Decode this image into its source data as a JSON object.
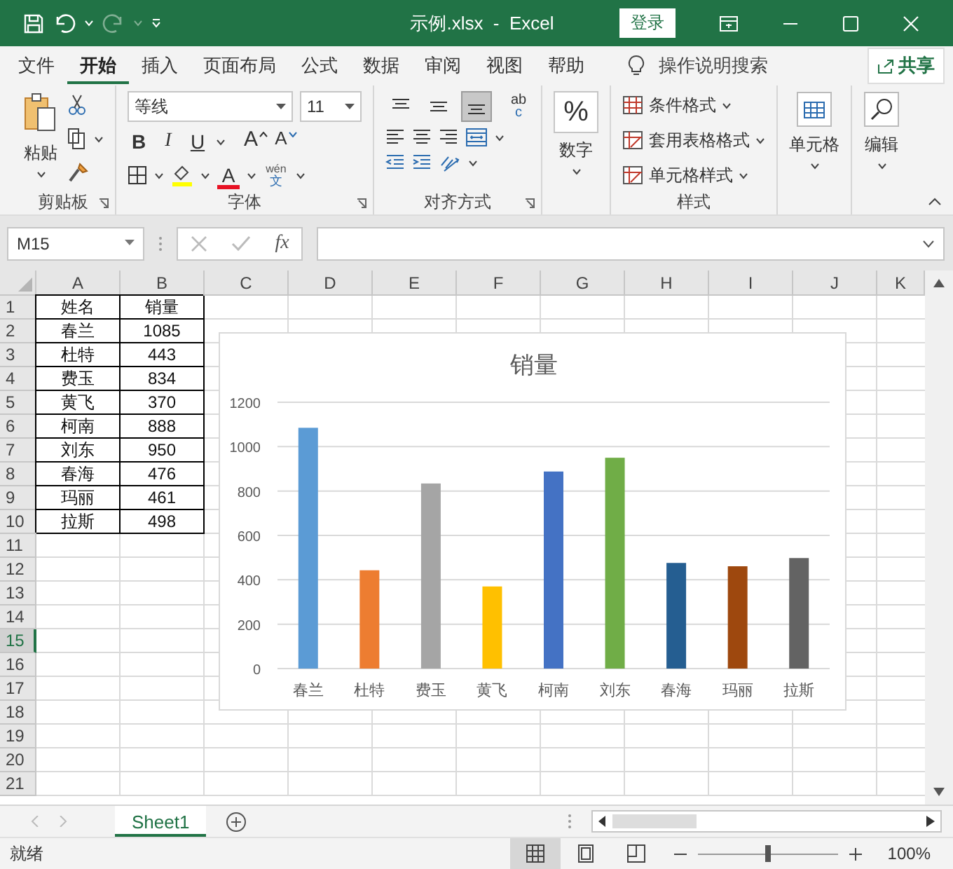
{
  "title_bar": {
    "title": "示例.xlsx  -  Excel",
    "login": "登录"
  },
  "ribbon_tabs": [
    {
      "label": "文件",
      "selected": false
    },
    {
      "label": "开始",
      "selected": true
    },
    {
      "label": "插入",
      "selected": false
    },
    {
      "label": "页面布局",
      "selected": false
    },
    {
      "label": "公式",
      "selected": false
    },
    {
      "label": "数据",
      "selected": false
    },
    {
      "label": "审阅",
      "selected": false
    },
    {
      "label": "视图",
      "selected": false
    },
    {
      "label": "帮助",
      "selected": false
    }
  ],
  "tell_me": "操作说明搜索",
  "share": "共享",
  "ribbon": {
    "clipboard": {
      "paste": "粘贴",
      "label": "剪贴板"
    },
    "font": {
      "name": "等线",
      "size": "11",
      "bold": "B",
      "italic": "I",
      "underline": "U",
      "grow": "A",
      "shrink": "A",
      "font_color": "A",
      "phonetic_top": "wén",
      "phonetic_bottom": "文",
      "label": "字体"
    },
    "alignment": {
      "vertical_align": [
        {
          "selected": false
        },
        {
          "selected": false
        },
        {
          "selected": true
        }
      ],
      "wrap_top": "ab",
      "wrap_bottom": "c",
      "label": "对齐方式"
    },
    "number": {
      "symbol": "%",
      "label": "数字"
    },
    "styles": {
      "items": [
        "条件格式",
        "套用表格格式",
        "单元格样式"
      ],
      "label": "样式"
    },
    "cells": {
      "label": "单元格"
    },
    "editing": {
      "label": "编辑"
    }
  },
  "formula_bar": {
    "name_box": "M15",
    "fx": "fx"
  },
  "sheet": {
    "columns": [
      "A",
      "B",
      "C",
      "D",
      "E",
      "F",
      "G",
      "H",
      "I",
      "J",
      "K"
    ],
    "row_headers": [
      {
        "label": "1",
        "selected": false
      },
      {
        "label": "2",
        "selected": false
      },
      {
        "label": "3",
        "selected": false
      },
      {
        "label": "4",
        "selected": false
      },
      {
        "label": "5",
        "selected": false
      },
      {
        "label": "6",
        "selected": false
      },
      {
        "label": "7",
        "selected": false
      },
      {
        "label": "8",
        "selected": false
      },
      {
        "label": "9",
        "selected": false
      },
      {
        "label": "10",
        "selected": false
      },
      {
        "label": "11",
        "selected": false
      },
      {
        "label": "12",
        "selected": false
      },
      {
        "label": "13",
        "selected": false
      },
      {
        "label": "14",
        "selected": false
      },
      {
        "label": "15",
        "selected": true
      },
      {
        "label": "16",
        "selected": false
      },
      {
        "label": "17",
        "selected": false
      },
      {
        "label": "18",
        "selected": false
      },
      {
        "label": "19",
        "selected": false
      },
      {
        "label": "20",
        "selected": false
      },
      {
        "label": "21",
        "selected": false
      }
    ],
    "cells": [
      [
        "姓名",
        "销量"
      ],
      [
        "春兰",
        "1085"
      ],
      [
        "杜特",
        "443"
      ],
      [
        "费玉",
        "834"
      ],
      [
        "黄飞",
        "370"
      ],
      [
        "柯南",
        "888"
      ],
      [
        "刘东",
        "950"
      ],
      [
        "春海",
        "476"
      ],
      [
        "玛丽",
        "461"
      ],
      [
        "拉斯",
        "498"
      ]
    ],
    "chart": {
      "chart_data": {
        "type": "bar",
        "grid": true,
        "categories": [
          "春兰",
          "杜特",
          "费玉",
          "黄飞",
          "柯南",
          "刘东",
          "春海",
          "玛丽",
          "拉斯"
        ],
        "series": [
          {
            "name": "销量",
            "values": [
              1085,
              443,
              834,
              370,
              888,
              950,
              476,
              461,
              498
            ],
            "colors": [
              "#5b9bd5",
              "#ed7d31",
              "#a5a5a5",
              "#ffc000",
              "#4472c4",
              "#70ad47",
              "#255e91",
              "#9e480e",
              "#636363"
            ]
          }
        ],
        "ylim": [
          0,
          1200
        ],
        "yticks": [
          0,
          200,
          400,
          600,
          800,
          1000,
          1200
        ]
      }
    }
  },
  "sheet_tabs": [
    {
      "label": "Sheet1",
      "selected": true
    }
  ],
  "status_bar": {
    "status": "就绪",
    "views": [
      {
        "selected": true
      },
      {
        "selected": false
      },
      {
        "selected": false
      }
    ],
    "zoom": {
      "level": 0.5,
      "reading": "100%"
    }
  }
}
